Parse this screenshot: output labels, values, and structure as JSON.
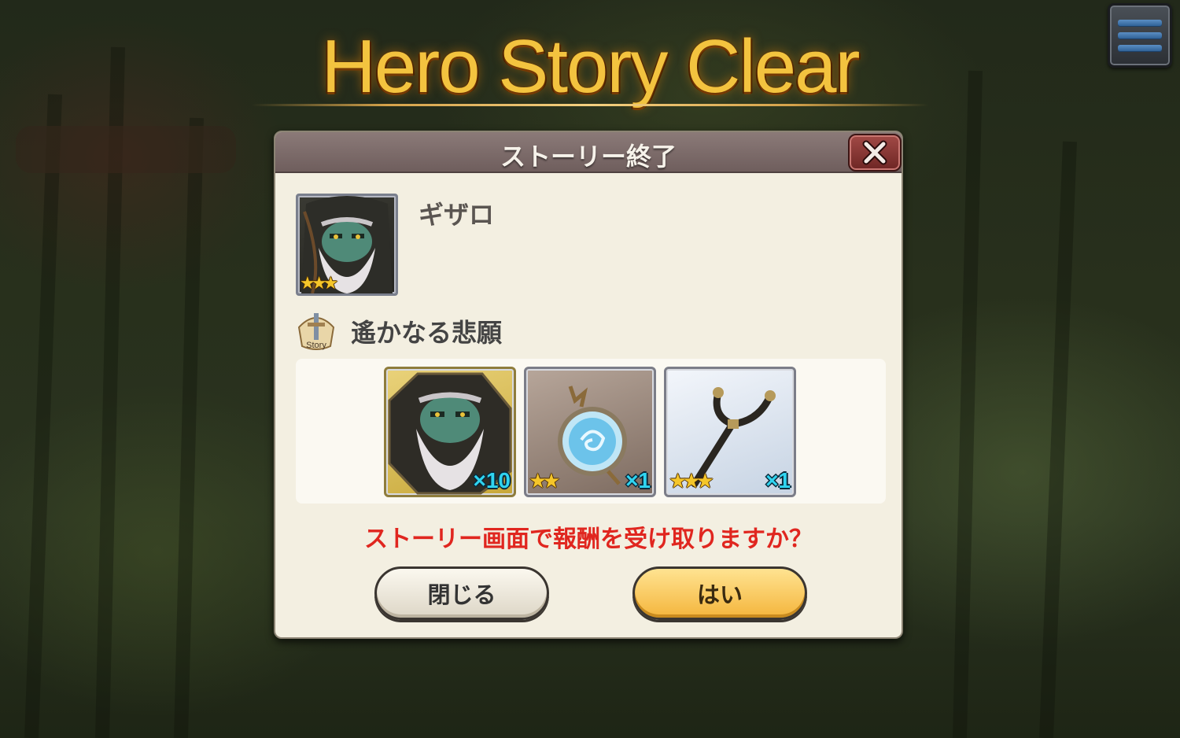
{
  "header": {
    "title": "Hero Story Clear",
    "menu_icon": "hamburger-menu-icon"
  },
  "dialog": {
    "title": "ストーリー終了",
    "close_icon": "close-x-icon",
    "hero": {
      "name": "ギザロ",
      "stars": "★★★"
    },
    "story": {
      "icon_label": "Story",
      "title": "遙かなる悲願"
    },
    "rewards": [
      {
        "item": "hero-shard",
        "stars": "",
        "quantity": "×10"
      },
      {
        "item": "orb",
        "stars": "★★",
        "quantity": "×1"
      },
      {
        "item": "staff",
        "stars": "★★★",
        "quantity": "×1"
      }
    ],
    "prompt": "ストーリー画面で報酬を受け取りますか？",
    "buttons": {
      "close": "閉じる",
      "yes": "はい"
    }
  },
  "colors": {
    "title_gold": "#f3c33f",
    "prompt_red": "#e0261f",
    "yes_button": "#f4b53c",
    "quantity_cyan": "#2fd4f0"
  }
}
